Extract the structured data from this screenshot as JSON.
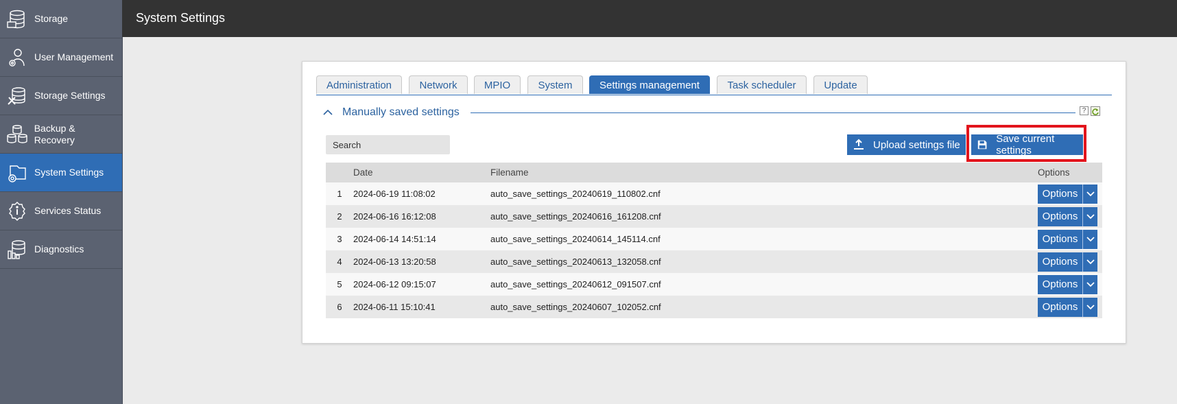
{
  "header": {
    "title": "System Settings"
  },
  "sidebar": {
    "items": [
      {
        "label": "Storage",
        "icon": "storage-icon"
      },
      {
        "label": "User Management",
        "icon": "user-management-icon"
      },
      {
        "label": "Storage Settings",
        "icon": "storage-settings-icon"
      },
      {
        "label": "Backup & Recovery",
        "icon": "backup-recovery-icon"
      },
      {
        "label": "System Settings",
        "icon": "system-settings-icon",
        "active": true
      },
      {
        "label": "Services Status",
        "icon": "services-status-icon"
      },
      {
        "label": "Diagnostics",
        "icon": "diagnostics-icon"
      }
    ]
  },
  "tabs": [
    {
      "label": "Administration"
    },
    {
      "label": "Network"
    },
    {
      "label": "MPIO"
    },
    {
      "label": "System"
    },
    {
      "label": "Settings management",
      "active": true
    },
    {
      "label": "Task scheduler"
    },
    {
      "label": "Update"
    }
  ],
  "section": {
    "title": "Manually saved settings",
    "help": "?"
  },
  "search": {
    "placeholder": "Search"
  },
  "buttons": {
    "upload": "Upload settings file",
    "save": "Save current settings"
  },
  "table": {
    "columns": {
      "num": "",
      "date": "Date",
      "filename": "Filename",
      "options": "Options"
    },
    "rows": [
      {
        "num": "1",
        "date": "2024-06-19 11:08:02",
        "filename": "auto_save_settings_20240619_110802.cnf",
        "option": "Options"
      },
      {
        "num": "2",
        "date": "2024-06-16 16:12:08",
        "filename": "auto_save_settings_20240616_161208.cnf",
        "option": "Options"
      },
      {
        "num": "3",
        "date": "2024-06-14 14:51:14",
        "filename": "auto_save_settings_20240614_145114.cnf",
        "option": "Options"
      },
      {
        "num": "4",
        "date": "2024-06-13 13:20:58",
        "filename": "auto_save_settings_20240613_132058.cnf",
        "option": "Options"
      },
      {
        "num": "5",
        "date": "2024-06-12 09:15:07",
        "filename": "auto_save_settings_20240612_091507.cnf",
        "option": "Options"
      },
      {
        "num": "6",
        "date": "2024-06-11 15:10:41",
        "filename": "auto_save_settings_20240607_102052.cnf",
        "option": "Options"
      }
    ]
  },
  "colors": {
    "accent": "#2f6db5",
    "sidebar": "#5b6271",
    "header": "#333333",
    "highlight": "#e2141c"
  }
}
